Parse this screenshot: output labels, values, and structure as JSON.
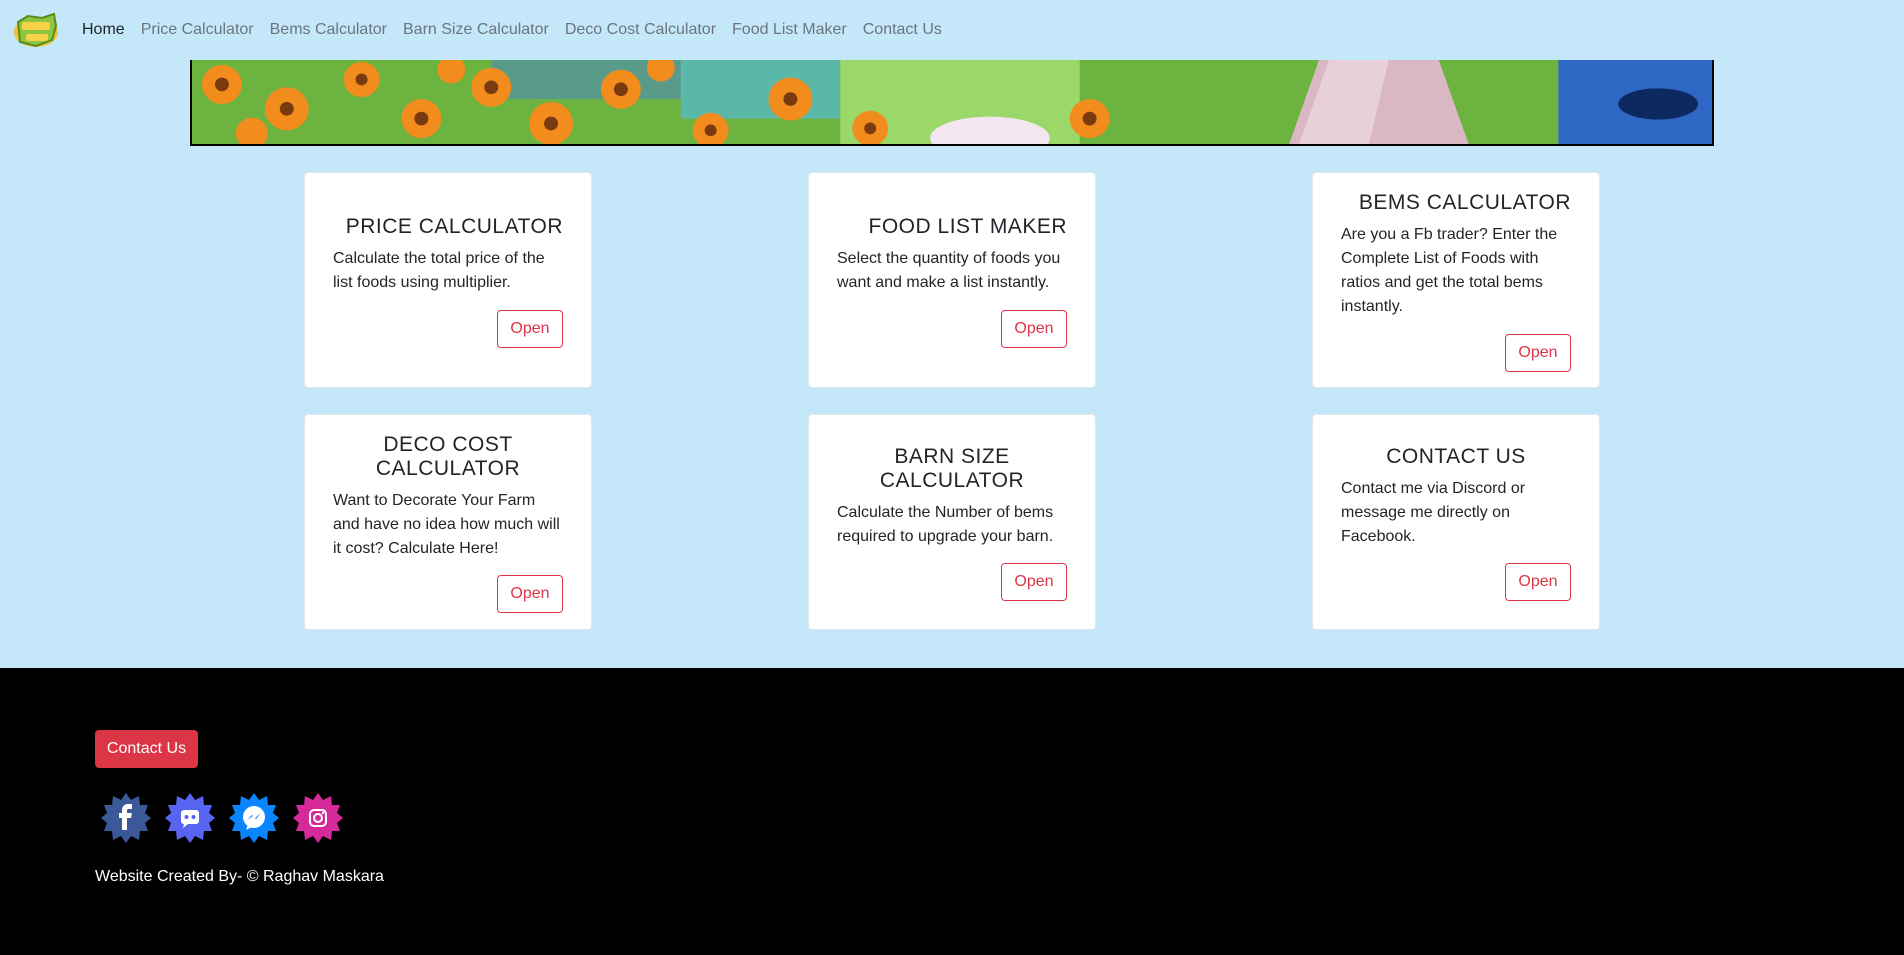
{
  "nav": {
    "items": [
      {
        "label": "Home",
        "active": true
      },
      {
        "label": "Price Calculator"
      },
      {
        "label": "Bems Calculator"
      },
      {
        "label": "Barn Size Calculator"
      },
      {
        "label": "Deco Cost Calculator"
      },
      {
        "label": "Food List Maker"
      },
      {
        "label": "Contact Us"
      }
    ]
  },
  "cards": [
    {
      "title": "PRICE CALCULATOR",
      "text": "Calculate the total price of the list foods using multiplier.",
      "button": "Open"
    },
    {
      "title": "FOOD LIST MAKER",
      "text": "Select the quantity of foods you want and make a list instantly.",
      "button": "Open"
    },
    {
      "title": "BEMS CALCULATOR",
      "text": "Are you a Fb trader? Enter the Complete List of Foods with ratios and get the total bems instantly.",
      "button": "Open"
    },
    {
      "title": "DECO COST CALCULATOR",
      "text": "Want to Decorate Your Farm and have no idea how much will it cost? Calculate Here!",
      "button": "Open"
    },
    {
      "title": "BARN SIZE CALCULATOR",
      "text": "Calculate the Number of bems required to upgrade your barn.",
      "button": "Open"
    },
    {
      "title": "CONTACT US",
      "text": "Contact me via Discord or message me directly on Facebook.",
      "button": "Open"
    }
  ],
  "footer": {
    "contact_label": "Contact Us",
    "socials": [
      {
        "icon": "facebook-icon",
        "color": "#3b5998"
      },
      {
        "icon": "discord-icon",
        "color": "#5865f2"
      },
      {
        "icon": "messenger-icon",
        "color": "#0a84ff"
      },
      {
        "icon": "instagram-icon",
        "color": "#d62a9a"
      }
    ],
    "credit": "Website Created By- © Raghav Maskara"
  },
  "colors": {
    "background": "#c4e7fa",
    "accent": "#dc3545",
    "footer": "#000000"
  }
}
